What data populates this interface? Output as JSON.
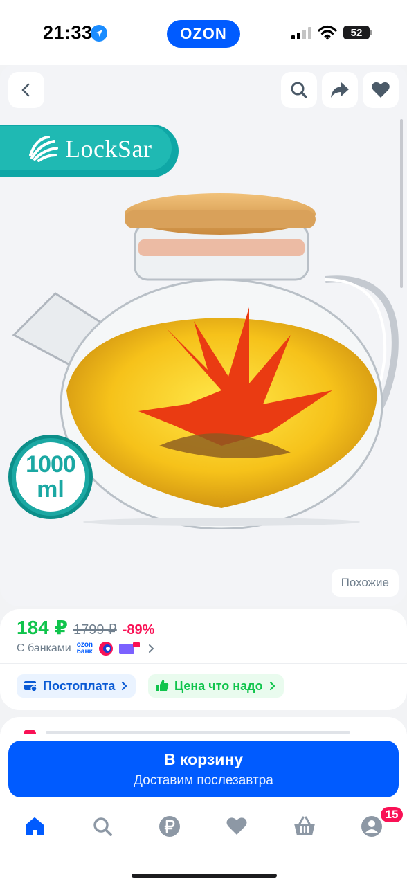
{
  "status_bar": {
    "time": "21:33",
    "brand": "OZON",
    "battery": "52"
  },
  "gallery": {
    "brand_logo_text": "LockSar",
    "volume_badge": {
      "number": "1000",
      "unit": "ml"
    },
    "similar_label": "Похожие",
    "icons": [
      "back-icon",
      "search-icon",
      "share-icon",
      "heart-icon"
    ]
  },
  "price": {
    "current": "184 ₽",
    "old": "1799 ₽",
    "discount": "-89%",
    "banks_label": "С банками",
    "ozon_bank_line1": "ozon",
    "ozon_bank_line2": "банк"
  },
  "chips": {
    "postpay": "Постоплата",
    "good_price": "Цена что надо"
  },
  "cart": {
    "title": "В корзину",
    "subtitle": "Доставим послезавтра"
  },
  "tabbar": {
    "icons": [
      "home-icon",
      "search-icon",
      "ruble-icon",
      "favorites-icon",
      "basket-icon",
      "profile-icon"
    ],
    "profile_badge": "15"
  },
  "colors": {
    "brand_blue": "#005bff",
    "price_green": "#10c44c",
    "discount_pink": "#f91155",
    "teal": "#1fb9b3"
  }
}
